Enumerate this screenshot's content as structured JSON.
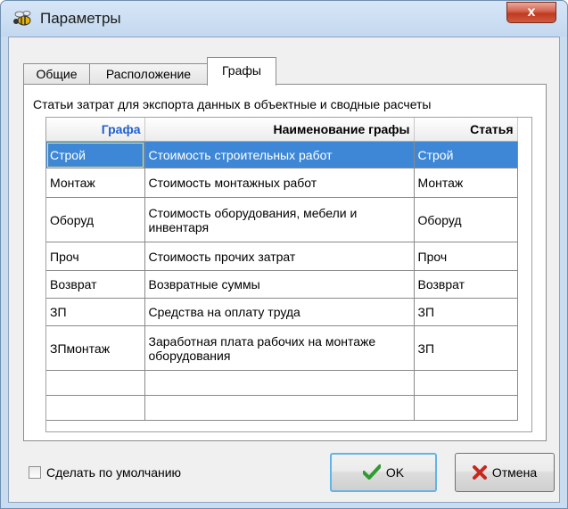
{
  "window": {
    "title": "Параметры",
    "close_label": "x"
  },
  "tabs": [
    {
      "label": "Общие",
      "active": false
    },
    {
      "label": "Расположение",
      "active": false
    },
    {
      "label": "Графы",
      "active": true
    }
  ],
  "panel": {
    "caption": "Статьи затрат для экспорта данных в объектные и сводные расчеты"
  },
  "table": {
    "headers": [
      "Графа",
      "Наименование графы",
      "Статья"
    ],
    "rows": [
      {
        "grafa": "Строй",
        "name": "Стоимость строительных работ",
        "statya": "Строй",
        "selected": true
      },
      {
        "grafa": "Монтаж",
        "name": "Стоимость монтажных работ",
        "statya": "Монтаж"
      },
      {
        "grafa": "Оборуд",
        "name": "Стоимость оборудования, мебели и инвентаря",
        "statya": "Оборуд"
      },
      {
        "grafa": "Проч",
        "name": "Стоимость прочих затрат",
        "statya": "Проч"
      },
      {
        "grafa": "Возврат",
        "name": "Возвратные суммы",
        "statya": "Возврат"
      },
      {
        "grafa": "ЗП",
        "name": "Средства на оплату труда",
        "statya": "ЗП"
      },
      {
        "grafa": "ЗПмонтаж",
        "name": "Заработная плата рабочих на монтаже оборудования",
        "statya": "ЗП"
      },
      {
        "grafa": "",
        "name": "",
        "statya": ""
      },
      {
        "grafa": "",
        "name": "",
        "statya": ""
      }
    ]
  },
  "footer": {
    "default_checkbox_label": "Сделать по умолчанию",
    "default_checked": false,
    "ok_label": "OK",
    "cancel_label": "Отмена"
  },
  "colors": {
    "header_accent": "#1f5fd0",
    "selection": "#3d87d6",
    "ok_icon": "#2f9a2f",
    "cancel_icon": "#c8281e"
  }
}
